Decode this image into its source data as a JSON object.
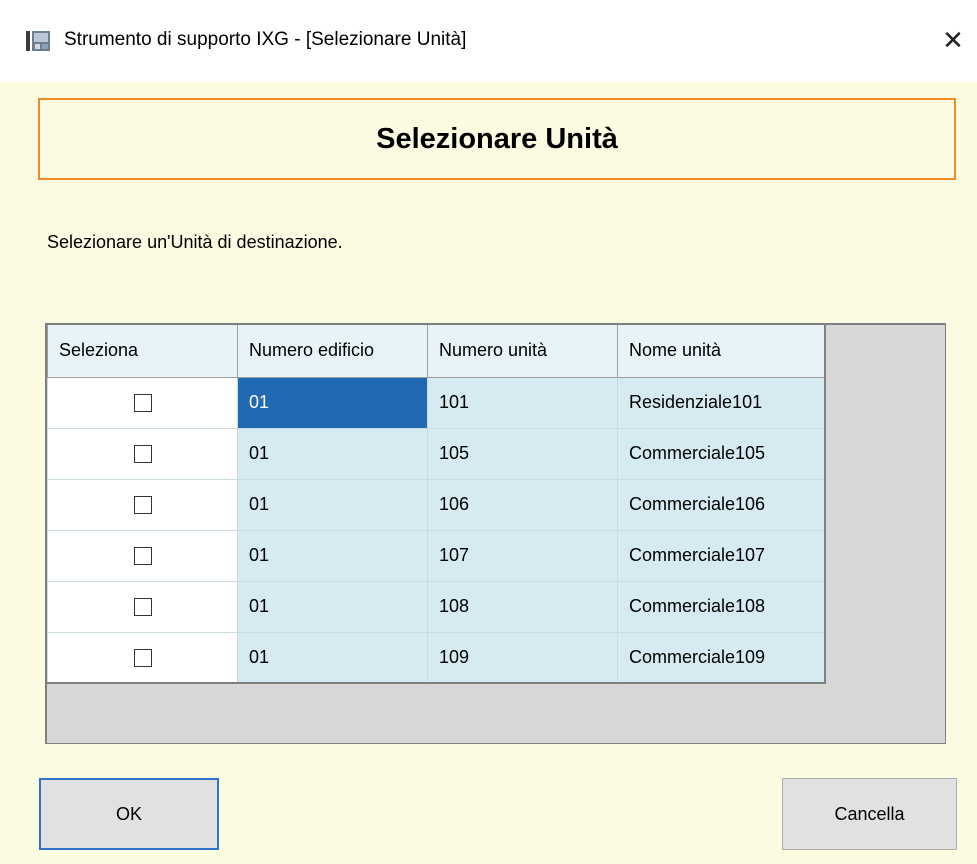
{
  "window": {
    "title": "Strumento di supporto IXG - [Selezionare Unità]",
    "close_glyph": "✕"
  },
  "header": {
    "title": "Selezionare Unità"
  },
  "instruction": "Selezionare un'Unità di destinazione.",
  "grid": {
    "columns": [
      "Seleziona",
      "Numero edificio",
      "Numero unità",
      "Nome unità"
    ],
    "rows": [
      {
        "checked": false,
        "building": "01",
        "unit_number": "101",
        "unit_name": "Residenziale101",
        "selected_cell": true
      },
      {
        "checked": false,
        "building": "01",
        "unit_number": "105",
        "unit_name": "Commerciale105",
        "selected_cell": false
      },
      {
        "checked": false,
        "building": "01",
        "unit_number": "106",
        "unit_name": "Commerciale106",
        "selected_cell": false
      },
      {
        "checked": false,
        "building": "01",
        "unit_number": "107",
        "unit_name": "Commerciale107",
        "selected_cell": false
      },
      {
        "checked": false,
        "building": "01",
        "unit_number": "108",
        "unit_name": "Commerciale108",
        "selected_cell": false
      },
      {
        "checked": false,
        "building": "01",
        "unit_number": "109",
        "unit_name": "Commerciale109",
        "selected_cell": false
      }
    ]
  },
  "buttons": {
    "ok_label": "OK",
    "cancel_label": "Cancella"
  },
  "colors": {
    "header_border": "#f08a24",
    "selected_cell": "#2069b3",
    "row_background": "#d5ebf1",
    "window_background": "#fbfbe2"
  },
  "icons": {
    "app": "app-icon",
    "close": "close-icon",
    "checkbox": "checkbox-icon"
  }
}
